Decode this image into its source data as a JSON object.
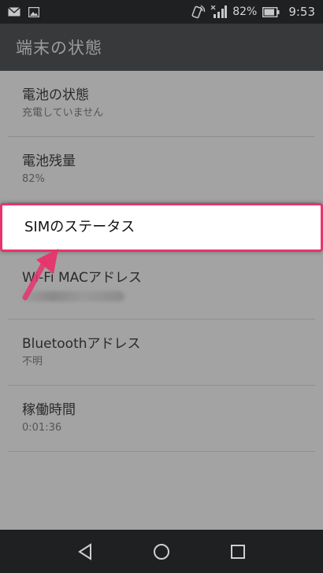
{
  "status_bar": {
    "battery_percent": "82%",
    "time": "9:53",
    "icons": [
      "mail-icon",
      "image-icon",
      "nfc-icon",
      "signal-icon",
      "battery-icon"
    ]
  },
  "app_bar": {
    "title": "端末の状態"
  },
  "list": {
    "items": [
      {
        "title": "電池の状態",
        "summary": "充電していません"
      },
      {
        "title": "電池残量",
        "summary": "82%"
      },
      {
        "title": "SIMのステータス",
        "summary": ""
      },
      {
        "title": "Wi-Fi MACアドレス",
        "summary": ""
      },
      {
        "title": "Bluetoothアドレス",
        "summary": "不明"
      },
      {
        "title": "稼働時間",
        "summary": "0:01:36"
      }
    ]
  },
  "highlight": {
    "color": "#e8336d"
  },
  "nav_bar": {
    "icons": [
      "back-icon",
      "home-icon",
      "recents-icon"
    ]
  }
}
